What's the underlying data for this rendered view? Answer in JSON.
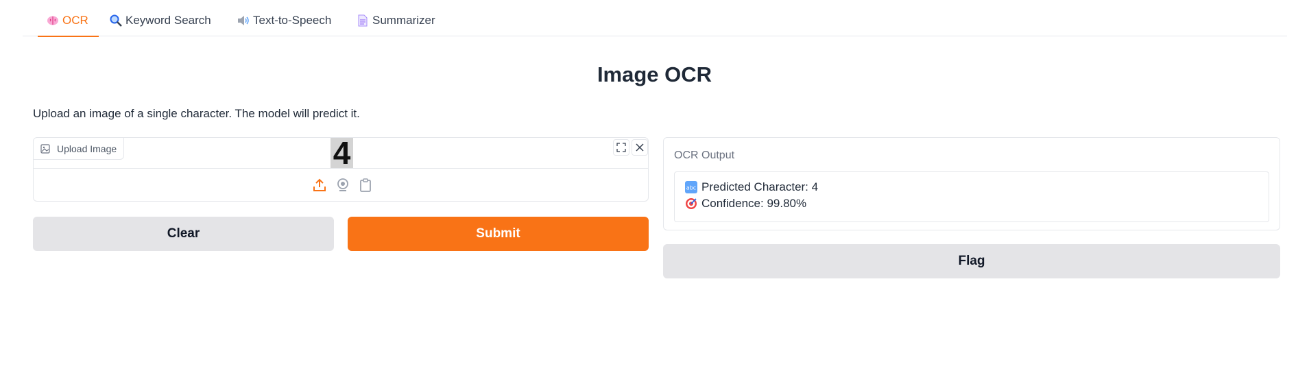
{
  "tabs": [
    {
      "label": "OCR",
      "icon": "brain-icon",
      "active": true
    },
    {
      "label": "Keyword Search",
      "icon": "magnifier-icon",
      "active": false
    },
    {
      "label": "Text-to-Speech",
      "icon": "speaker-icon",
      "active": false
    },
    {
      "label": "Summarizer",
      "icon": "document-icon",
      "active": false
    }
  ],
  "page": {
    "title": "Image OCR",
    "description": "Upload an image of a single character. The model will predict it."
  },
  "input": {
    "label": "Upload Image",
    "preview_character": "4"
  },
  "actions": {
    "clear": "Clear",
    "submit": "Submit",
    "flag": "Flag"
  },
  "output": {
    "label": "OCR Output",
    "predicted_text": "Predicted Character: 4",
    "confidence_text": "Confidence: 99.80%"
  },
  "colors": {
    "accent": "#f97316",
    "secondary_button": "#e4e4e7",
    "border": "#e5e7eb"
  }
}
